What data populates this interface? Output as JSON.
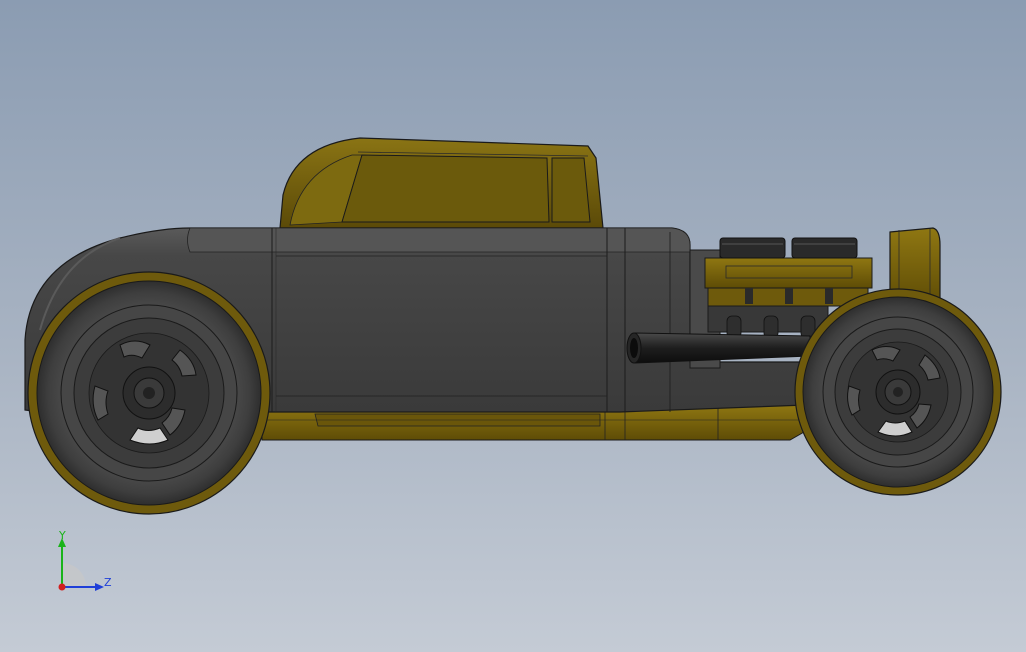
{
  "viewport": {
    "background_top": "#8b9cb2",
    "background_bottom": "#c4cbd5"
  },
  "model": {
    "body_color": "#424242",
    "accent_color": "#6e5a0c",
    "tire_color": "#4a4a4a"
  },
  "triad": {
    "y_label": "Y",
    "z_label": "Z",
    "y_color": "#19b319",
    "z_color": "#1f3fd8",
    "x_color": "#d21e1e"
  }
}
